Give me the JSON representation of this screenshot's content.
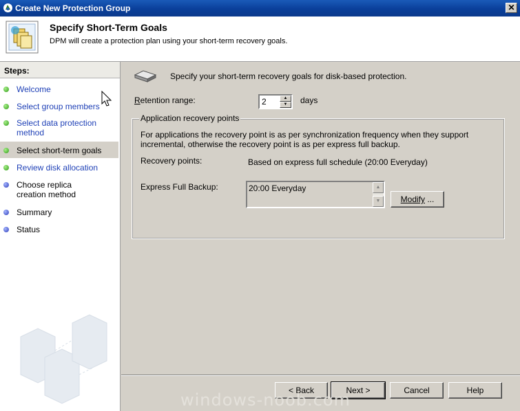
{
  "window": {
    "title": "Create New Protection Group",
    "close_glyph": "✕"
  },
  "header": {
    "title": "Specify Short-Term Goals",
    "subtitle": "DPM will create a protection plan using your short-term recovery goals."
  },
  "steps": {
    "heading": "Steps:",
    "items": [
      {
        "label": "Welcome",
        "state": "done"
      },
      {
        "label": "Select group members",
        "state": "done"
      },
      {
        "label": "Select data protection method",
        "state": "done"
      },
      {
        "label": "Select short-term goals",
        "state": "current"
      },
      {
        "label": "Review disk allocation",
        "state": "pending-link"
      },
      {
        "label": "Choose replica creation method",
        "state": "pending"
      },
      {
        "label": "Summary",
        "state": "pending"
      },
      {
        "label": "Status",
        "state": "pending"
      }
    ]
  },
  "main": {
    "intro": "Specify your short-term recovery goals for disk-based protection.",
    "retention": {
      "label_first": "R",
      "label_rest": "etention range:",
      "value": "2",
      "unit": "days"
    },
    "group": {
      "title": "Application recovery points",
      "description": "For applications the recovery point is as per synchronization frequency when they support incremental, otherwise the recovery point is as per express full backup.",
      "recovery_points_label": "Recovery points:",
      "recovery_points_value": "Based on express full schedule (20:00 Everyday)",
      "express_label": "Express Full Backup:",
      "express_items": [
        "20:00 Everyday"
      ],
      "modify_label_first": "Modify",
      "modify_label_rest": " ..."
    }
  },
  "footer": {
    "back_label": "< Back",
    "next_label": "Next >",
    "cancel_label": "Cancel",
    "help_label": "Help"
  },
  "watermark": "windows-noob.com",
  "colors": {
    "title_bar": "#0a3f9a",
    "link": "#1d3fb6",
    "panel": "#d4d0c8",
    "done_dot": "#2f9a17",
    "pending_dot": "#2c3cb8"
  }
}
